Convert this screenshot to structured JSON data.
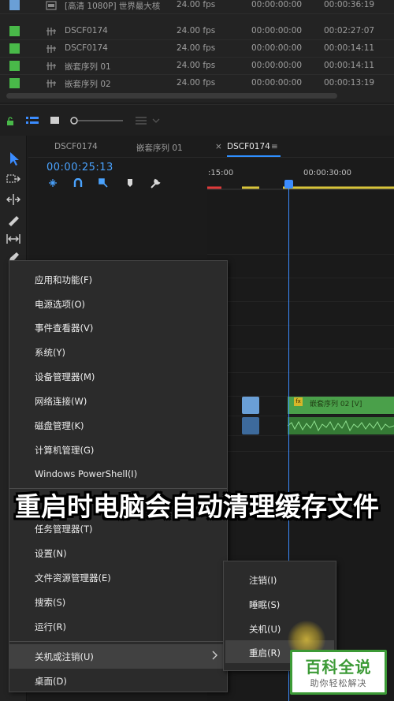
{
  "project": {
    "rows": [
      {
        "name": "[高清 1080P] 世界最大核",
        "fps": "24.00 fps",
        "start": "00:00:00:00",
        "end": "00:00:36:19",
        "swatch": "#6a9fd6"
      },
      {
        "name": "DSCF0174",
        "fps": "24.00 fps",
        "start": "00:00:00:00",
        "end": "00:02:27:07",
        "swatch": "#49b949"
      },
      {
        "name": "DSCF0174",
        "fps": "24.00 fps",
        "start": "00:00:00:00",
        "end": "00:00:14:11",
        "swatch": "#49b949"
      },
      {
        "name": "嵌套序列 01",
        "fps": "24.00 fps",
        "start": "00:00:00:00",
        "end": "00:00:14:11",
        "swatch": "#49b949"
      },
      {
        "name": "嵌套序列 02",
        "fps": "24.00 fps",
        "start": "00:00:00:00",
        "end": "00:00:13:19",
        "swatch": "#49b949"
      }
    ]
  },
  "timeline": {
    "tabs": [
      "DSCF0174",
      "嵌套序列 01",
      "DSCF0174"
    ],
    "close_glyph": "×",
    "menu_glyph": "≡",
    "timecode": "00:00:25:13",
    "ruler_left": ":15:00",
    "ruler_right": "00:00:30:00",
    "clip_label": "嵌套序列 02 [V]",
    "fx_label": "fx"
  },
  "context_menu": {
    "items": [
      "应用和功能(F)",
      "电源选项(O)",
      "事件查看器(V)",
      "系统(Y)",
      "设备管理器(M)",
      "网络连接(W)",
      "磁盘管理(K)",
      "计算机管理(G)",
      "Windows PowerShell(I)",
      "任务管理器(T)",
      "设置(N)",
      "文件资源管理器(E)",
      "搜索(S)",
      "运行(R)",
      "关机或注销(U)",
      "桌面(D)"
    ]
  },
  "submenu": {
    "items": [
      "注销(I)",
      "睡眠(S)",
      "关机(U)",
      "重启(R)"
    ]
  },
  "caption": "重启时电脑会自动清理缓存文件",
  "watermark": {
    "main": "百科全说",
    "sub": "助你轻松解决"
  },
  "colors": {
    "accent_blue": "#3b8cff",
    "timecode_blue": "#4aa3ff",
    "clip_green": "#4aa04a",
    "clip_blue": "#6a9fd6",
    "watermark_green": "#3c9a36"
  }
}
